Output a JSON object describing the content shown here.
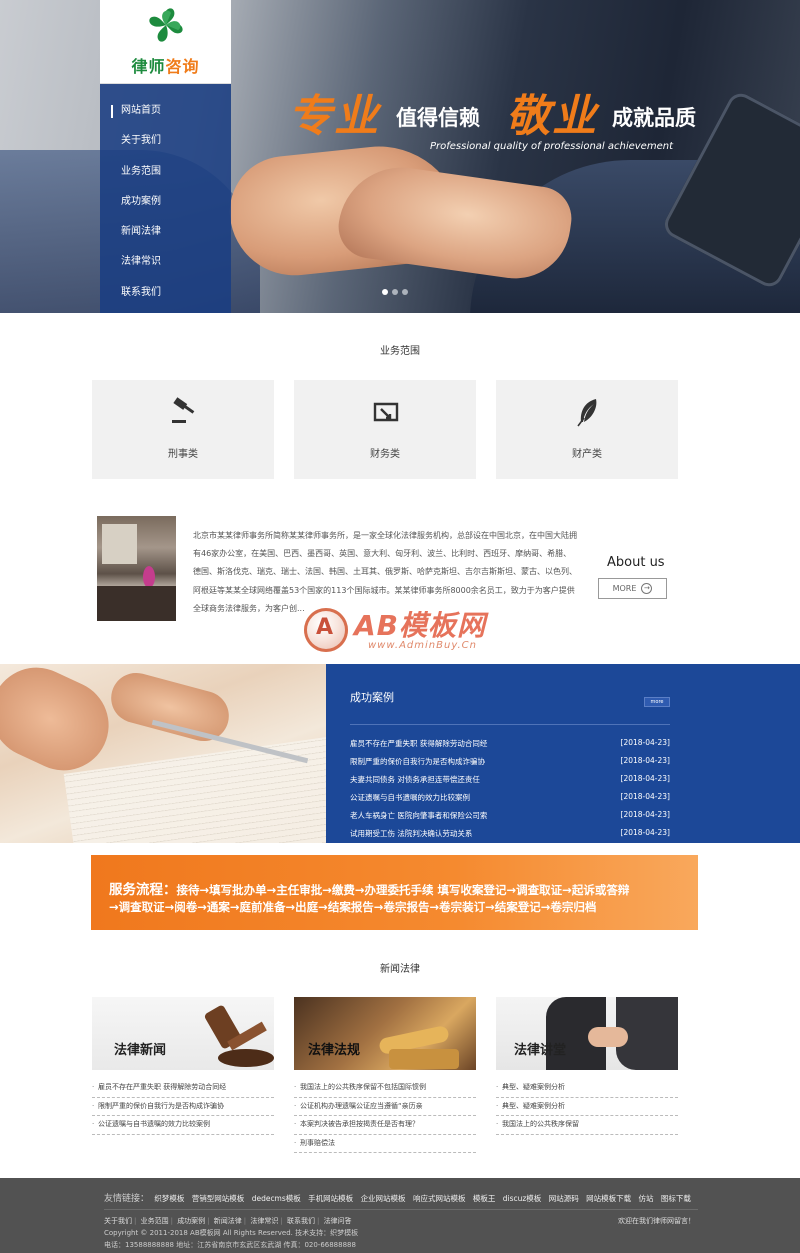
{
  "brand": {
    "logo_main": "律师",
    "logo_accent": "咨询",
    "green": "#1d8b3e",
    "orange": "#f07c1a",
    "blue": "#1c4898"
  },
  "nav": [
    "网站首页",
    "关于我们",
    "业务范围",
    "成功案例",
    "新闻法律",
    "法律常识",
    "联系我们"
  ],
  "banner": {
    "calli_1": "专业",
    "text_1": "值得信赖",
    "calli_2": "敬业",
    "text_2": "成就品质",
    "english": "Professional quality of professional achievement"
  },
  "services": {
    "title": "业务范围",
    "items": [
      {
        "label": "刑事类",
        "icon": "gavel-icon"
      },
      {
        "label": "财务类",
        "icon": "finance-icon"
      },
      {
        "label": "财产类",
        "icon": "feather-icon"
      }
    ]
  },
  "about": {
    "heading": "About us",
    "more": "MORE",
    "text": "北京市某某律师事务所简称某某律师事务所，是一家全球化法律服务机构，总部设在中国北京，在中国大陆拥有46家办公室，在美国、巴西、墨西哥、英国、意大利、匈牙利、波兰、比利时、西班牙、摩纳哥、希腊、德国、斯洛伐克、瑞克、瑞士、法国、韩国、土耳其、俄罗斯、哈萨克斯坦、吉尔吉斯斯坦、蒙古、以色列、阿根廷等某某全球网络覆盖53个国家的113个国际城市。某某律师事务所8000余名员工，致力于为客户提供全球商务法律服务，为客户创..."
  },
  "watermark": {
    "letter": "A",
    "title": "AB模板网",
    "url": "www.AdminBuy.Cn"
  },
  "cases": {
    "title": "成功案例",
    "more": "more",
    "rows": [
      {
        "title": "雇员不存在严重失职 获得解除劳动合同经",
        "date": "[2018-04-23]"
      },
      {
        "title": "限制严重的保价自我行为是否构成诈骗协",
        "date": "[2018-04-23]"
      },
      {
        "title": "夫妻共同债务 对债务承担连带偿还责任",
        "date": "[2018-04-23]"
      },
      {
        "title": "公证遗嘱与自书遗嘱的效力比较案例",
        "date": "[2018-04-23]"
      },
      {
        "title": "老人车祸身亡 医院向肇事者和保险公司索",
        "date": "[2018-04-23]"
      },
      {
        "title": "试用期受工伤 法院判决确认劳动关系",
        "date": "[2018-04-23]"
      }
    ]
  },
  "process": {
    "head": "服务流程：",
    "line1": "接待→填写批办单→主任审批→缴费→办理委托手续 填写收案登记→调查取证→起诉或答辩",
    "line2": "→调查取证→阅卷→通案→庭前准备→出庭→结案报告→卷宗报告→卷宗装订→结案登记→卷宗归档"
  },
  "news": {
    "title": "新闻法律",
    "columns": [
      {
        "caption": "法律新闻",
        "items": [
          "雇员不存在严重失职 获得解除劳动合同经",
          "限制严重的保价自我行为是否构成诈骗协",
          "公证遗嘱与自书遗嘱的效力比较案例"
        ]
      },
      {
        "caption": "法律法规",
        "items": [
          "我国法上的公共秩序保留不包括国际惯例",
          "公证机构办理遗嘱公证应当遵循“亲历亲",
          "本案判决被告承担按揭责任是否有理？",
          "刑事赔偿法"
        ]
      },
      {
        "caption": "法律讲堂",
        "items": [
          "典型、疑难案例分析",
          "典型、疑难案例分析",
          "我国法上的公共秩序保留"
        ]
      }
    ]
  },
  "footer": {
    "links_label": "友情链接：",
    "links": [
      "织梦模板",
      "营销型网站模板",
      "dedecms模板",
      "手机网站模板",
      "企业网站模板",
      "响应式网站模板",
      "模板王",
      "discuz模板",
      "网站源码",
      "网站模板下载",
      "仿站",
      "图标下载"
    ],
    "nav": [
      "关于我们",
      "业务范围",
      "成功案例",
      "新闻法律",
      "法律常识",
      "联系我们",
      "法律问答"
    ],
    "copyright": "Copyright © 2011-2018 AB模板网 All Rights Reserved. 技术支持：织梦模板",
    "contact": "电话：13588888888 地址：江苏省南京市玄武区玄武湖 传真：020-66888888",
    "welcome": "欢迎在我们律师网留言！"
  }
}
